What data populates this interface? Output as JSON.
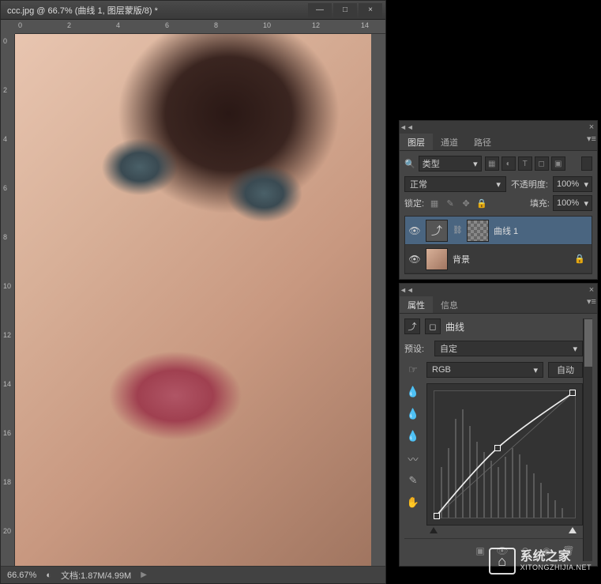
{
  "doc": {
    "title": "ccc.jpg @ 66.7% (曲线 1, 图层蒙版/8) *",
    "zoom": "66.67%",
    "filesize": "文档:1.87M/4.99M"
  },
  "ruler_h": [
    "0",
    "2",
    "4",
    "6",
    "8",
    "10",
    "12",
    "14"
  ],
  "ruler_v": [
    "0",
    "2",
    "4",
    "6",
    "8",
    "10",
    "12",
    "14",
    "16",
    "18",
    "20"
  ],
  "layers_panel": {
    "tabs": [
      "图层",
      "通道",
      "路径"
    ],
    "filter_kind": "类型",
    "blend_mode": "正常",
    "opacity_label": "不透明度:",
    "opacity_value": "100%",
    "lock_label": "锁定:",
    "fill_label": "填充:",
    "fill_value": "100%",
    "layers": [
      {
        "name": "曲线 1",
        "type": "adjustment",
        "visible": true,
        "selected": true
      },
      {
        "name": "背景",
        "type": "image",
        "visible": true,
        "locked": true
      }
    ]
  },
  "properties_panel": {
    "tabs": [
      "属性",
      "信息"
    ],
    "adj_name": "曲线",
    "preset_label": "预设:",
    "preset_value": "自定",
    "channel": "RGB",
    "auto_label": "自动",
    "curve_points": [
      {
        "x": 0.02,
        "y": 0.02
      },
      {
        "x": 0.45,
        "y": 0.55
      },
      {
        "x": 0.98,
        "y": 0.98
      }
    ]
  },
  "watermark": {
    "cn": "系统之家",
    "en": "XITONGZHIJIA.NET"
  }
}
